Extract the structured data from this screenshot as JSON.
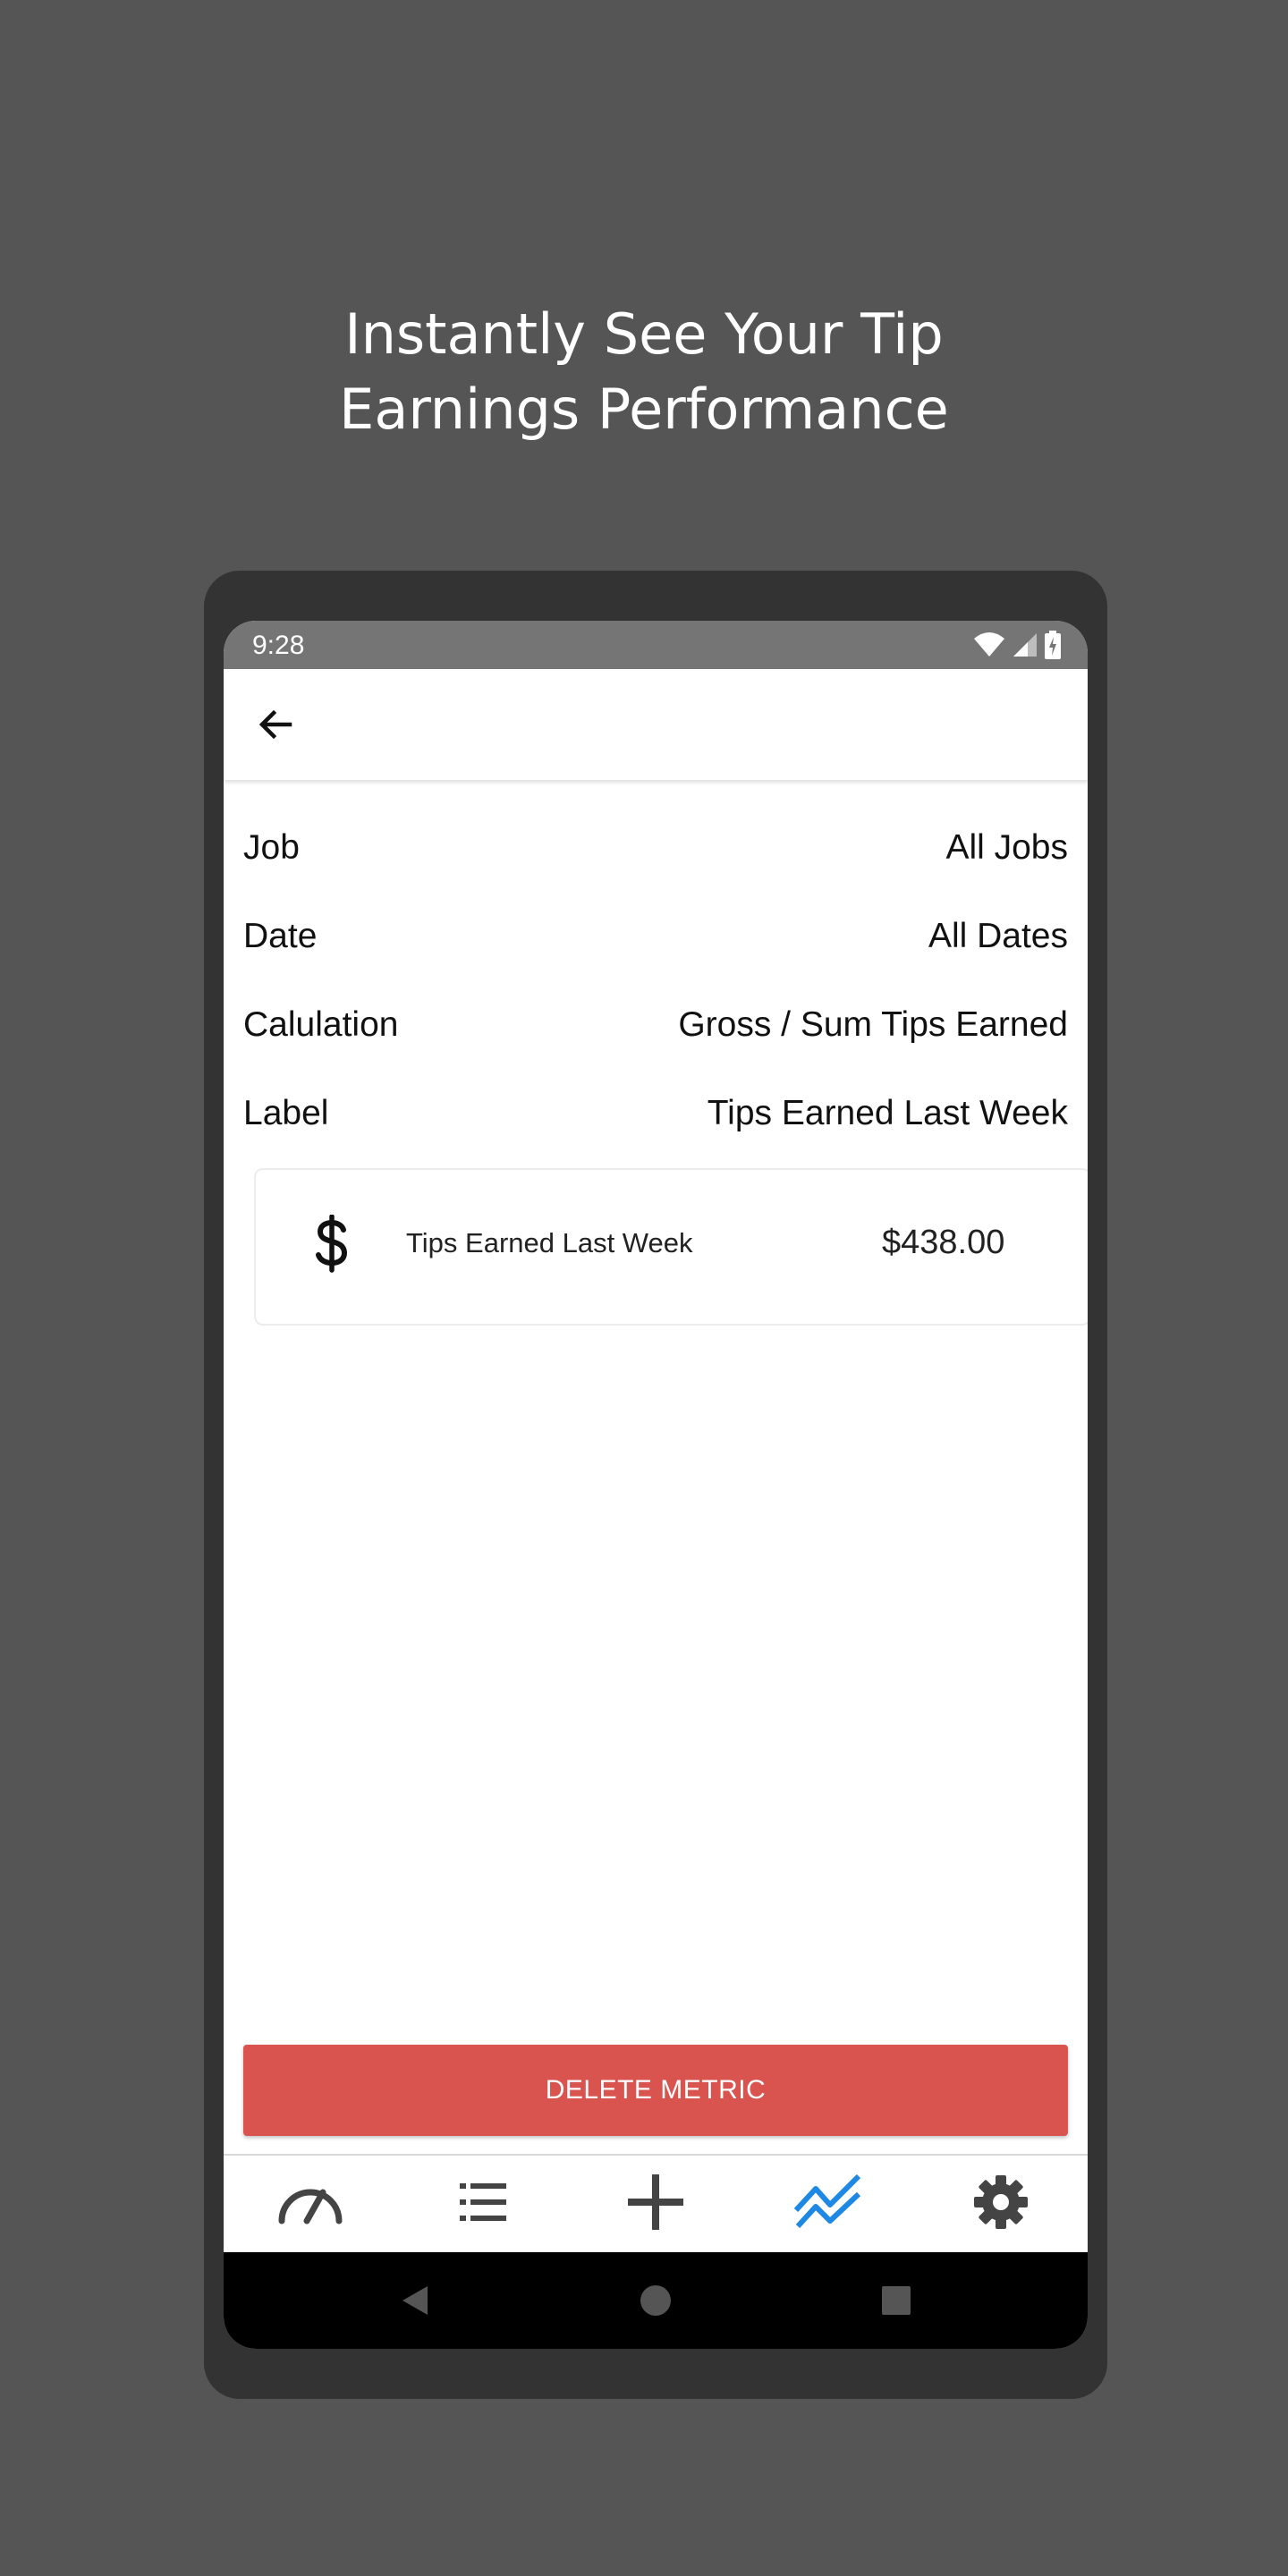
{
  "headline": {
    "line1": "Instantly See Your Tip",
    "line2": "Earnings Performance"
  },
  "status_bar": {
    "time": "9:28",
    "icons": [
      "wifi-icon",
      "cell-signal-icon",
      "battery-charging-icon"
    ]
  },
  "app_bar": {
    "back_icon": "arrow-left-icon"
  },
  "settings": [
    {
      "label": "Job",
      "value": "All Jobs"
    },
    {
      "label": "Date",
      "value": "All Dates"
    },
    {
      "label": "Calulation",
      "value": "Gross / Sum Tips Earned"
    },
    {
      "label": "Label",
      "value": "Tips Earned Last Week"
    }
  ],
  "metric_card": {
    "icon": "dollar-icon",
    "label": "Tips Earned Last Week",
    "value": "$438.00"
  },
  "delete_button": {
    "label": "DELETE METRIC",
    "color": "#d9534f"
  },
  "bottom_nav": {
    "items": [
      {
        "icon": "speedometer-icon",
        "active": false
      },
      {
        "icon": "list-icon",
        "active": false
      },
      {
        "icon": "plus-icon",
        "active": false
      },
      {
        "icon": "chart-line-icon",
        "active": true
      },
      {
        "icon": "gear-icon",
        "active": false
      }
    ],
    "active_color": "#1e88e5",
    "inactive_color": "#444444"
  },
  "system_nav": [
    "back-triangle-icon",
    "home-circle-icon",
    "recents-square-icon"
  ]
}
